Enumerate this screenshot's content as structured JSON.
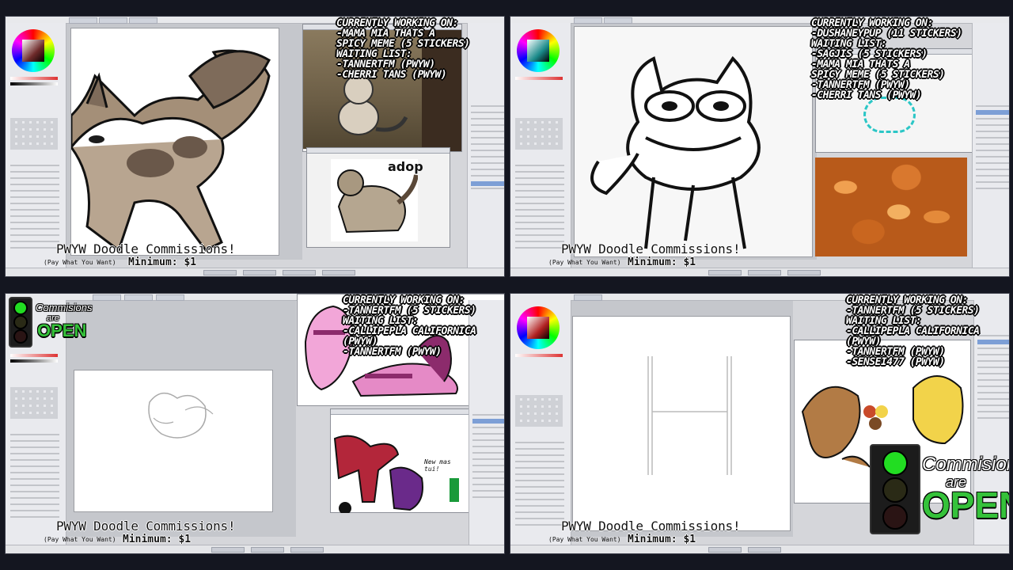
{
  "panes": {
    "top_left": {
      "overlay": "CURRENTLY WORKING ON:\n-MAMA MIA THATS A\n SPICY MEME (5 STICKERS)\nWAITING LIST:\n-TANNERTFM (PWYW)\n-CHERRI TANS (PWYW)",
      "banner": "PWYW Doodle Commissions!",
      "banner_sub": "(Pay What You Want)",
      "minimum": "Minimum: $1",
      "ref_text": "adop"
    },
    "top_right": {
      "overlay": "CURRENTLY WORKING ON:\n-DUSHANEYPUP (11 STICKERS)\nWAITING LIST:\n-SAGJIS (5 STICKERS)\n-MAMA MIA THATS A\n SPICY MEME (5 STICKERS)\n-TANNERTFM (PWYW)\n-CHERRI TANS (PWYW)",
      "banner": "PWYW Doodle Commissions!",
      "banner_sub": "(Pay What You Want)",
      "minimum": "Minimum: $1"
    },
    "bottom_left": {
      "overlay": "CURRENTLY WORKING ON:\n-TANNERTFM (5 STICKERS)\nWAITING LIST:\n-CALLIPEPLA CALIFORNICA\n (PWYW)\n-TANNERTFM (PWYW)",
      "banner": "PWYW Doodle Commissions!",
      "banner_sub": "(Pay What You Want)",
      "minimum": "Minimum: $1",
      "status_commissions": "Commisions",
      "status_are": "are",
      "status_open": "OPEN",
      "ref_note": "New mas tui!"
    },
    "bottom_right": {
      "overlay": "CURRENTLY WORKING ON:\n-TANNERTFM (5 STICKERS)\nWAITING LIST:\n-CALLIPEPLA CALIFORNICA\n (PWYW)\n-TANNERTFM (PWYW)\n-SENSEI477 (PWYW)",
      "banner": "PWYW Doodle Commissions!",
      "banner_sub": "(Pay What You Want)",
      "minimum": "Minimum: $1",
      "status_commissions": "Commisions",
      "status_are": "are",
      "status_open": "OPEN"
    }
  },
  "colors": {
    "background": "#141620",
    "ui_panel": "#e9eaee",
    "open_green": "#35c23a",
    "light_green": "#22dd22",
    "layer_selected": "#7d9fd6"
  },
  "icons": [
    "color-wheel-icon",
    "traffic-light-icon",
    "tool-palette-icon"
  ]
}
